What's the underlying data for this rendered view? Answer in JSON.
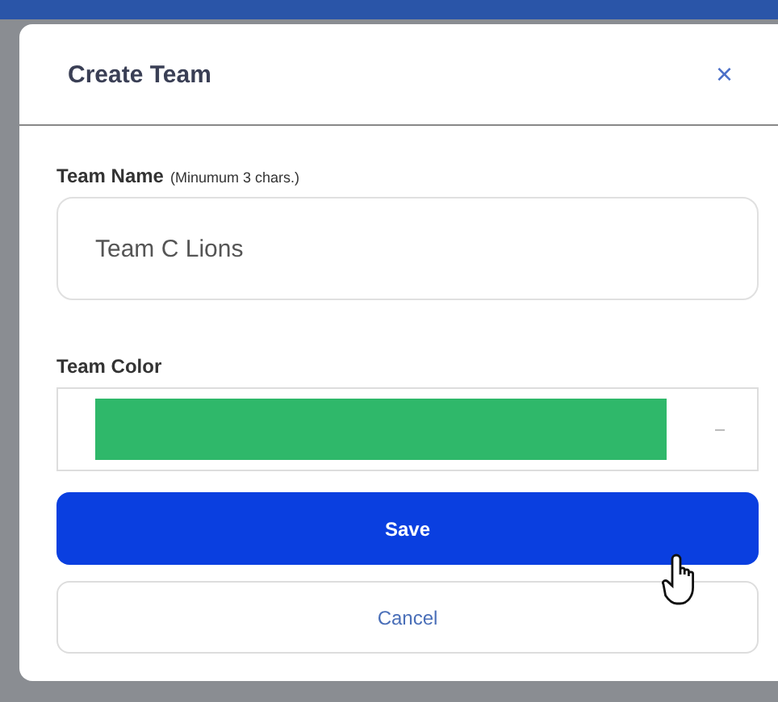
{
  "dialog": {
    "title": "Create Team",
    "close": "×"
  },
  "team_name": {
    "label": "Team Name",
    "hint": "(Minumum 3 chars.)",
    "value": "Team C Lions"
  },
  "team_color": {
    "label": "Team Color",
    "color": "#2fb86a"
  },
  "buttons": [
    {
      "kind": "primary",
      "label": "Save"
    },
    {
      "kind": "secondary",
      "label": "Cancel"
    }
  ]
}
